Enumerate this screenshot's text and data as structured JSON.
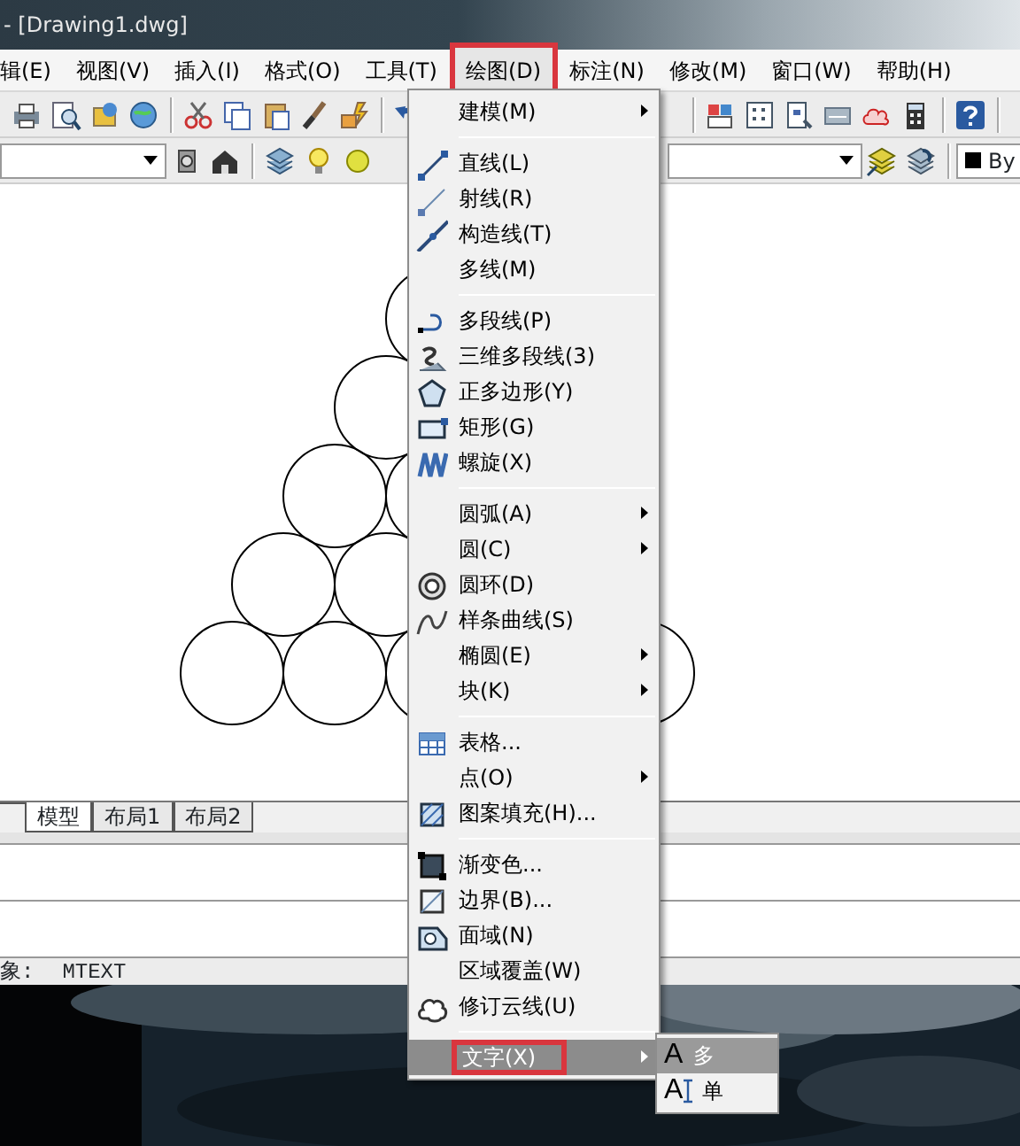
{
  "window": {
    "title": "- [Drawing1.dwg]"
  },
  "menu_bar": [
    {
      "label": "辑(E)",
      "selected": false,
      "annotated": false
    },
    {
      "label": "视图(V)",
      "selected": false,
      "annotated": false
    },
    {
      "label": "插入(I)",
      "selected": false,
      "annotated": false
    },
    {
      "label": "格式(O)",
      "selected": false,
      "annotated": false
    },
    {
      "label": "工具(T)",
      "selected": false,
      "annotated": false
    },
    {
      "label": "绘图(D)",
      "selected": true,
      "annotated": true
    },
    {
      "label": "标注(N)",
      "selected": false,
      "annotated": false
    },
    {
      "label": "修改(M)",
      "selected": false,
      "annotated": false
    },
    {
      "label": "窗口(W)",
      "selected": false,
      "annotated": false
    },
    {
      "label": "帮助(H)",
      "selected": false,
      "annotated": false
    }
  ],
  "color_control": {
    "text": "By"
  },
  "layout_tabs": [
    {
      "label": "模型",
      "selected": true
    },
    {
      "label": "布局1",
      "selected": false
    },
    {
      "label": "布局2",
      "selected": false
    }
  ],
  "command_line": {
    "prompt": "象:",
    "command": "MTEXT"
  },
  "draw_menu": {
    "items": [
      {
        "kind": "item",
        "label": "建模(M)",
        "icon": false,
        "submenu": true,
        "selected": false,
        "annotated": false
      },
      {
        "kind": "separator"
      },
      {
        "kind": "item",
        "label": "直线(L)",
        "icon": true,
        "submenu": false,
        "selected": false,
        "annotated": false
      },
      {
        "kind": "item",
        "label": "射线(R)",
        "icon": true,
        "submenu": false,
        "selected": false,
        "annotated": false
      },
      {
        "kind": "item",
        "label": "构造线(T)",
        "icon": true,
        "submenu": false,
        "selected": false,
        "annotated": false
      },
      {
        "kind": "item",
        "label": "多线(M)",
        "icon": false,
        "submenu": false,
        "selected": false,
        "annotated": false
      },
      {
        "kind": "separator"
      },
      {
        "kind": "item",
        "label": "多段线(P)",
        "icon": true,
        "submenu": false,
        "selected": false,
        "annotated": false
      },
      {
        "kind": "item",
        "label": "三维多段线(3)",
        "icon": true,
        "submenu": false,
        "selected": false,
        "annotated": false
      },
      {
        "kind": "item",
        "label": "正多边形(Y)",
        "icon": true,
        "submenu": false,
        "selected": false,
        "annotated": false
      },
      {
        "kind": "item",
        "label": "矩形(G)",
        "icon": true,
        "submenu": false,
        "selected": false,
        "annotated": false
      },
      {
        "kind": "item",
        "label": "螺旋(X)",
        "icon": true,
        "submenu": false,
        "selected": false,
        "annotated": false
      },
      {
        "kind": "separator"
      },
      {
        "kind": "item",
        "label": "圆弧(A)",
        "icon": false,
        "submenu": true,
        "selected": false,
        "annotated": false
      },
      {
        "kind": "item",
        "label": "圆(C)",
        "icon": false,
        "submenu": true,
        "selected": false,
        "annotated": false
      },
      {
        "kind": "item",
        "label": "圆环(D)",
        "icon": true,
        "submenu": false,
        "selected": false,
        "annotated": false
      },
      {
        "kind": "item",
        "label": "样条曲线(S)",
        "icon": true,
        "submenu": false,
        "selected": false,
        "annotated": false
      },
      {
        "kind": "item",
        "label": "椭圆(E)",
        "icon": false,
        "submenu": true,
        "selected": false,
        "annotated": false
      },
      {
        "kind": "item",
        "label": "块(K)",
        "icon": false,
        "submenu": true,
        "selected": false,
        "annotated": false
      },
      {
        "kind": "separator"
      },
      {
        "kind": "item",
        "label": "表格...",
        "icon": true,
        "submenu": false,
        "selected": false,
        "annotated": false
      },
      {
        "kind": "item",
        "label": "点(O)",
        "icon": false,
        "submenu": true,
        "selected": false,
        "annotated": false
      },
      {
        "kind": "item",
        "label": "图案填充(H)...",
        "icon": true,
        "submenu": false,
        "selected": false,
        "annotated": false
      },
      {
        "kind": "separator"
      },
      {
        "kind": "item",
        "label": "渐变色...",
        "icon": true,
        "submenu": false,
        "selected": false,
        "annotated": false
      },
      {
        "kind": "item",
        "label": "边界(B)...",
        "icon": true,
        "submenu": false,
        "selected": false,
        "annotated": false
      },
      {
        "kind": "item",
        "label": "面域(N)",
        "icon": true,
        "submenu": false,
        "selected": false,
        "annotated": false
      },
      {
        "kind": "item",
        "label": "区域覆盖(W)",
        "icon": false,
        "submenu": false,
        "selected": false,
        "annotated": false
      },
      {
        "kind": "item",
        "label": "修订云线(U)",
        "icon": true,
        "submenu": false,
        "selected": false,
        "annotated": false
      },
      {
        "kind": "separator"
      },
      {
        "kind": "item",
        "label": "文字(X)",
        "icon": false,
        "submenu": true,
        "selected": true,
        "annotated": true
      }
    ]
  },
  "text_submenu": {
    "items": [
      {
        "glyph": "A",
        "label": "多",
        "selected": true,
        "cursor": false
      },
      {
        "glyph": "A",
        "label": "单",
        "selected": false,
        "cursor": true
      }
    ]
  }
}
